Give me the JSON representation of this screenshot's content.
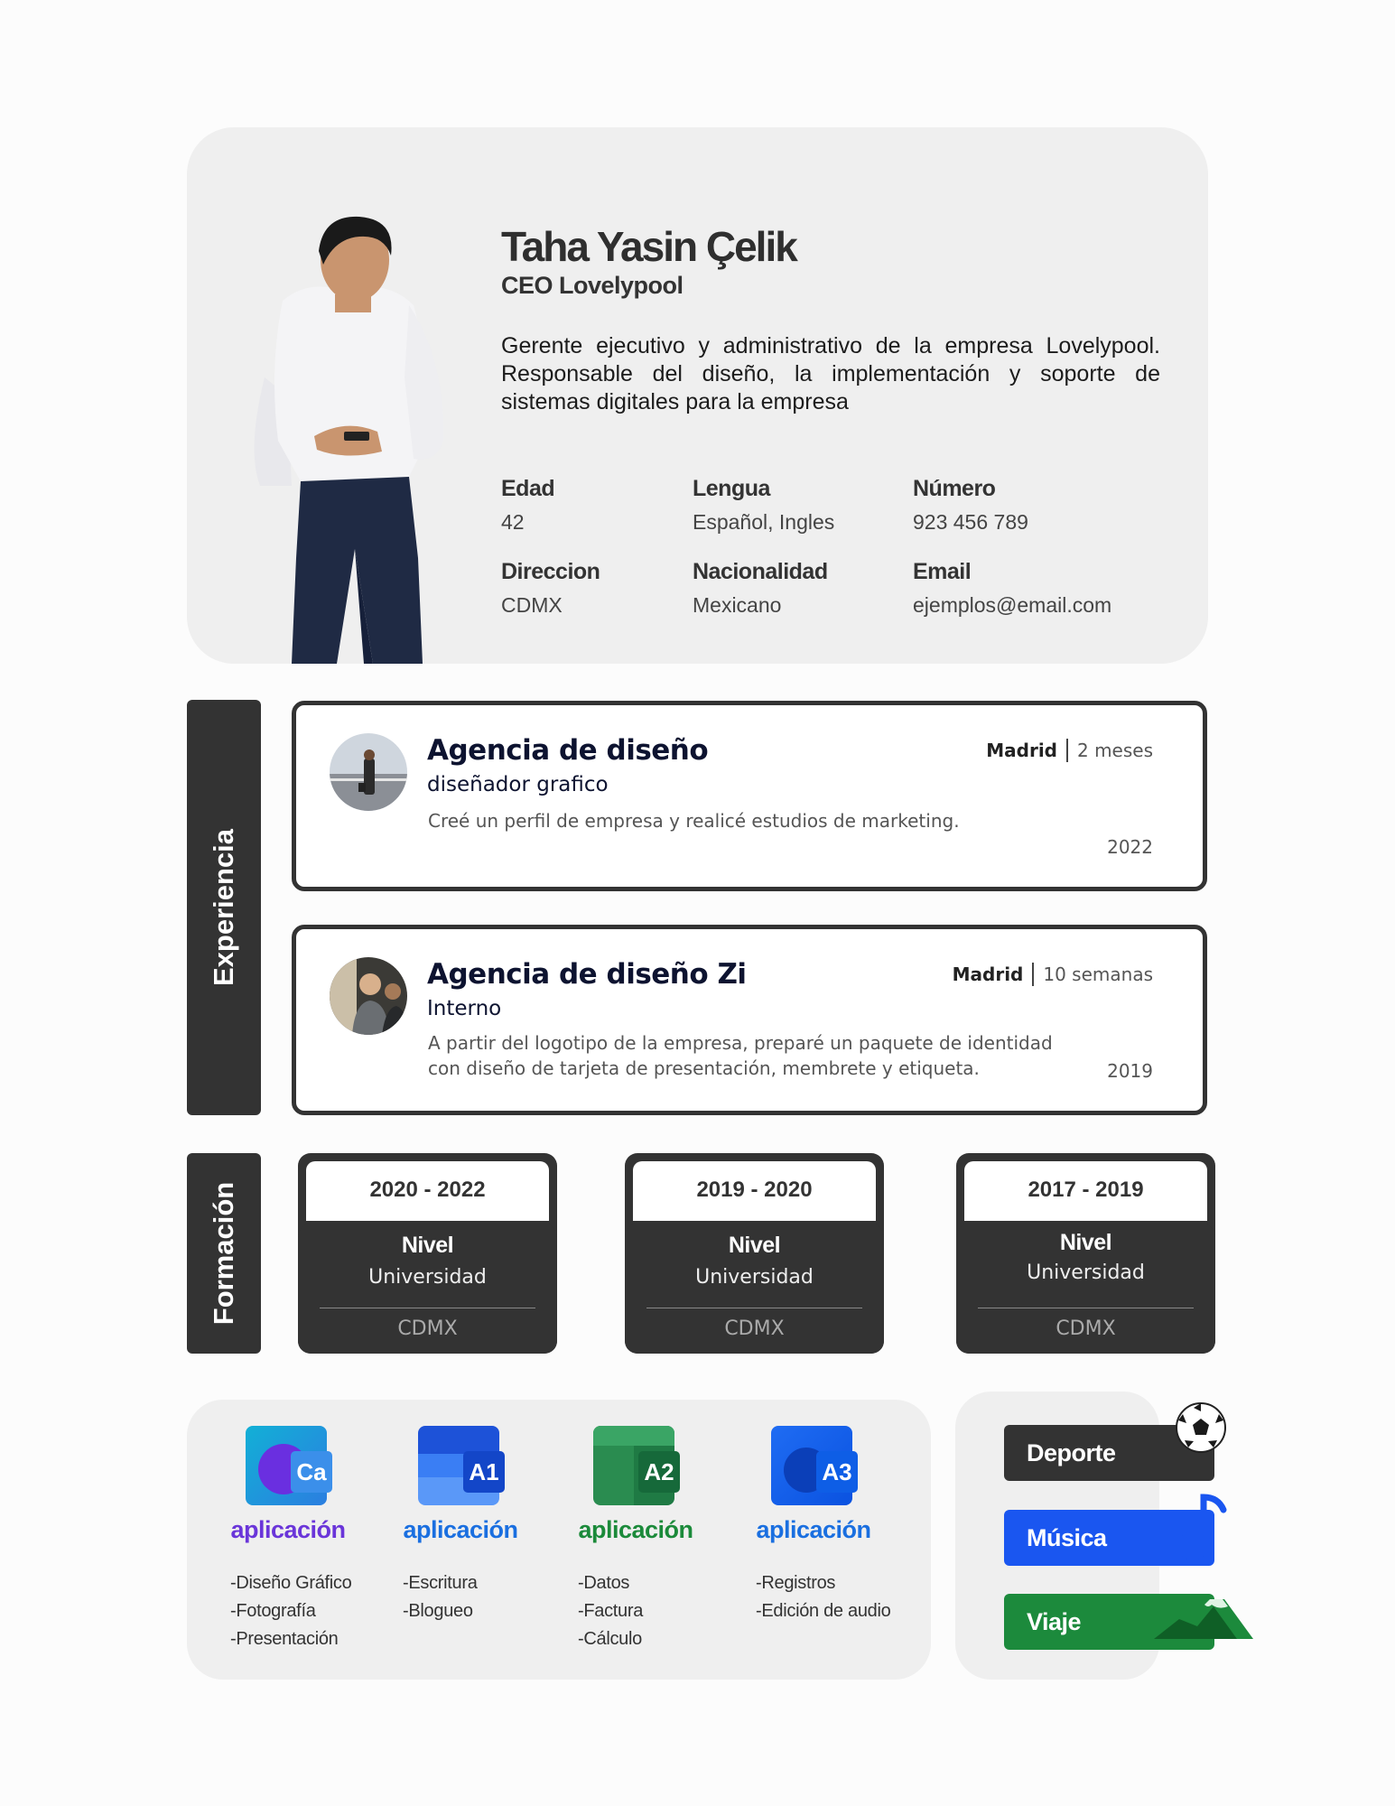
{
  "profile": {
    "name": "Taha Yasin Çelik",
    "role": "CEO Lovelypool",
    "bio": "Gerente ejecutivo y administrativo de la empresa Lovelypool. Responsable del diseño, la implementación y soporte de sistemas digitales para la empresa"
  },
  "info": [
    {
      "label": "Edad",
      "value": "42"
    },
    {
      "label": "Lengua",
      "value": "Español, Ingles"
    },
    {
      "label": "Número",
      "value": "923 456 789"
    },
    {
      "label": "Direccion",
      "value": "CDMX"
    },
    {
      "label": "Nacionalidad",
      "value": "Mexicano"
    },
    {
      "label": "Email",
      "value": "ejemplos@email.com"
    }
  ],
  "sections": {
    "experience": "Experiencia",
    "education": "Formación"
  },
  "experience": [
    {
      "company": "Agencia de diseño",
      "position": "diseñador grafico",
      "city": "Madrid",
      "duration": "2 meses",
      "description": "Creé un perfil de empresa y realicé estudios de marketing.",
      "year": "2022"
    },
    {
      "company": "Agencia de diseño Zi",
      "position": "Interno",
      "city": "Madrid",
      "duration": "10 semanas",
      "description": "A partir del logotipo de la empresa, preparé un paquete de identidad con diseño de tarjeta de presentación, membrete y etiqueta.",
      "year": "2019"
    }
  ],
  "education": [
    {
      "years": "2020 - 2022",
      "level": "Nivel",
      "institution": "Universidad",
      "city": "CDMX"
    },
    {
      "years": "2019 - 2020",
      "level": "Nivel",
      "institution": "Universidad",
      "city": "CDMX"
    },
    {
      "years": "2017 - 2019",
      "level": "Nivel",
      "institution": "Universidad",
      "city": "CDMX"
    }
  ],
  "apps": [
    {
      "code": "Ca",
      "name": "aplicación",
      "color": "#6a35d9",
      "back": "#1f9fd8",
      "front": "#3a8ee8",
      "skills": [
        "-Diseño Gráfico",
        "-Fotografía",
        "-Presentación"
      ]
    },
    {
      "code": "A1",
      "name": "aplicación",
      "color": "#1a6fe0",
      "back": "#2b6ef0",
      "front": "#1753d6",
      "skills": [
        "-Escritura",
        "-Blogueo"
      ]
    },
    {
      "code": "A2",
      "name": "aplicación",
      "color": "#1b8a3a",
      "back": "#27874a",
      "front": "#1e7040",
      "skills": [
        "-Datos",
        "-Factura",
        "-Cálculo"
      ]
    },
    {
      "code": "A3",
      "name": "aplicación",
      "color": "#1a6fe0",
      "back": "#1a6cf0",
      "front": "#0b5ae0",
      "skills": [
        "-Registros",
        "-Edición de audio"
      ]
    }
  ],
  "hobbies": [
    {
      "label": "Deporte",
      "color": "#333333",
      "icon": "soccer-ball-icon"
    },
    {
      "label": "Música",
      "color": "#1a56f0",
      "icon": "music-note-icon"
    },
    {
      "label": "Viaje",
      "color": "#1c8a3c",
      "icon": "mountain-icon"
    }
  ]
}
